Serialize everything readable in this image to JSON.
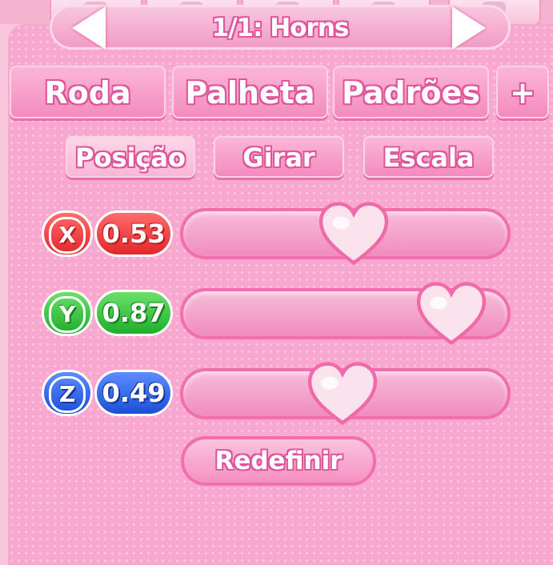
{
  "header": {
    "title": "1/1: Horns"
  },
  "tabs": [
    {
      "label": "Roda"
    },
    {
      "label": "Palheta"
    },
    {
      "label": "Padrões"
    },
    {
      "label": "+"
    }
  ],
  "subtabs": [
    {
      "label": "Posição",
      "active": true
    },
    {
      "label": "Girar",
      "active": false
    },
    {
      "label": "Escala",
      "active": false
    }
  ],
  "sliders": [
    {
      "axis": "X",
      "value": "0.53",
      "level": 0.53,
      "color": "#e4262b"
    },
    {
      "axis": "Y",
      "value": "0.87",
      "level": 0.87,
      "color": "#1fae2a"
    },
    {
      "axis": "Z",
      "value": "0.49",
      "level": 0.49,
      "color": "#1c4fd6"
    }
  ],
  "reset_label": "Redefinir",
  "colors": {
    "panel": "#f8a7cf",
    "accent": "#e0559a"
  }
}
